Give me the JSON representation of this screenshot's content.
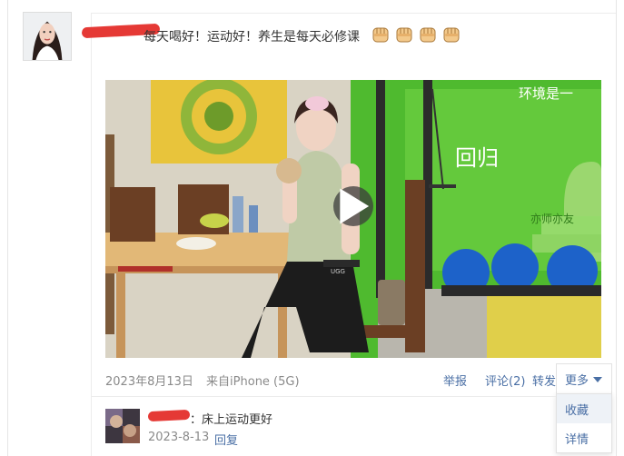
{
  "post": {
    "text": "每天喝好！运动好！养生是每天必修课",
    "emojis": [
      "fist-icon",
      "fist-icon",
      "fist-icon",
      "fist-icon"
    ],
    "date": "2023年8月13日",
    "source": "来自iPhone (5G)"
  },
  "actions": {
    "report": "举报",
    "comment": "评论(2)",
    "forward": "转发",
    "more": "更多"
  },
  "more_menu": {
    "items": [
      "收藏",
      "详情"
    ]
  },
  "comment": {
    "text": "：床上运动更好",
    "date": "2023-8-13",
    "reply": "回复"
  },
  "video_overlay": {
    "wall_text_right": "环境是一",
    "sign_text": "回归",
    "small_text": "亦师亦友"
  },
  "colors": {
    "link": "#4a6fa5",
    "meta": "#8a8a8a",
    "redaction": "#e53935",
    "gym_green": "#5cc832"
  }
}
